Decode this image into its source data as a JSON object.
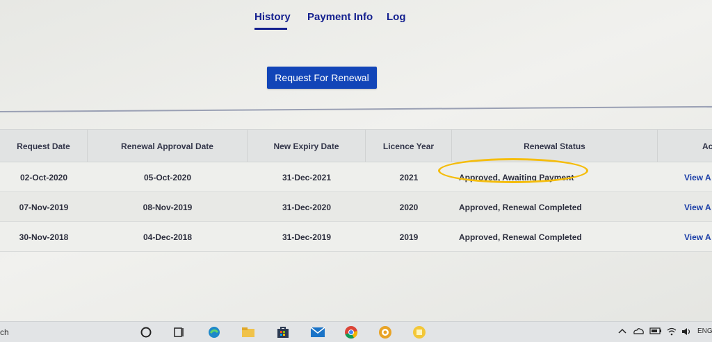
{
  "tabs": [
    {
      "label": "History"
    },
    {
      "label": "Payment Info"
    },
    {
      "label": "Log"
    }
  ],
  "actions": {
    "renew_label": "Request For Renewal"
  },
  "table": {
    "headers": [
      "Request Date",
      "Renewal Approval Date",
      "New Expiry Date",
      "Licence Year",
      "Renewal Status",
      "Ac"
    ],
    "rows": [
      [
        "02-Oct-2020",
        "05-Oct-2020",
        "31-Dec-2021",
        "2021",
        "Approved, Awaiting Payment",
        "View A"
      ],
      [
        "07-Nov-2019",
        "08-Nov-2019",
        "31-Dec-2020",
        "2020",
        "Approved, Renewal Completed",
        "View A"
      ],
      [
        "30-Nov-2018",
        "04-Dec-2018",
        "31-Dec-2019",
        "2019",
        "Approved, Renewal Completed",
        "View A"
      ]
    ]
  },
  "taskbar": {
    "search_text": "ch",
    "language": "ENG",
    "icons": [
      "cortana-icon",
      "task-view-icon",
      "edge-icon",
      "file-explorer-icon",
      "store-icon",
      "mail-icon",
      "chrome-icon",
      "app-icon",
      "sticky-notes-icon"
    ],
    "tray_icons": [
      "chevron-up-icon",
      "onedrive-icon",
      "battery-icon",
      "wifi-icon",
      "volume-icon"
    ]
  },
  "colors": {
    "accent": "#14208f",
    "button": "#1245b8",
    "highlight": "#f5bd0c",
    "link": "#1c3fa8"
  }
}
